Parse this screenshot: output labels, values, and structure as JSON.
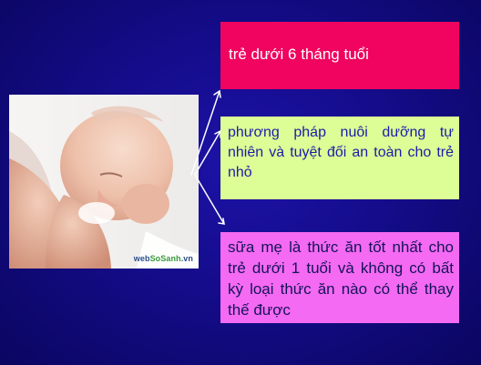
{
  "slide": {
    "background_color": "#140c8a",
    "photo": {
      "watermark_prefix": "web",
      "watermark_brand": "SoSanh",
      "watermark_suffix": ".vn"
    },
    "boxes": [
      {
        "text": "trẻ dưới 6 tháng  tuổi",
        "color": "#f0045f"
      },
      {
        "text": "phương pháp nuôi dưỡng tự nhiên và tuyệt đối an toàn cho trẻ nhỏ",
        "color": "#ddfd96"
      },
      {
        "text": "sữa mẹ là thức ăn tốt nhất cho trẻ dưới 1 tuổi và không có bất kỳ loại thức ăn nào có thể thay thế được",
        "color": "#f56af2"
      }
    ]
  }
}
